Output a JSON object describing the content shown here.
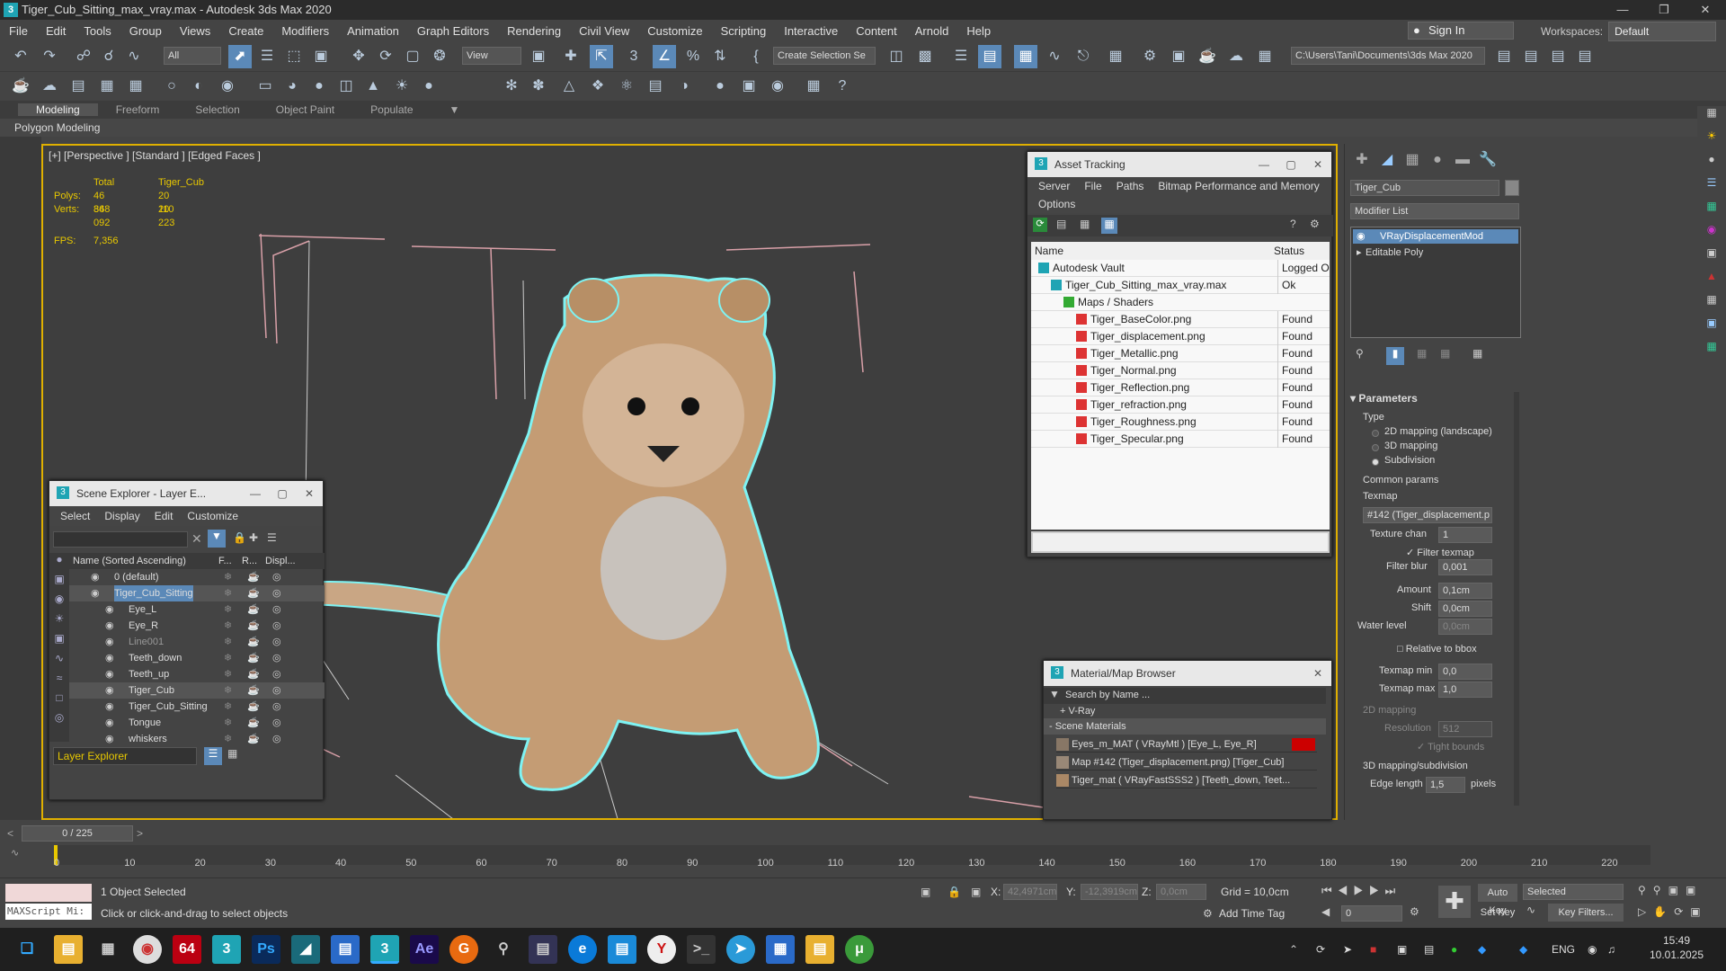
{
  "window": {
    "title": "Tiger_Cub_Sitting_max_vray.max - Autodesk 3ds Max 2020",
    "app_icon": "3"
  },
  "menu": [
    "File",
    "Edit",
    "Tools",
    "Group",
    "Views",
    "Create",
    "Modifiers",
    "Animation",
    "Graph Editors",
    "Rendering",
    "Civil View",
    "Customize",
    "Scripting",
    "Interactive",
    "Content",
    "Arnold",
    "Help"
  ],
  "signin": "Sign In",
  "workspaces": {
    "label": "Workspaces:",
    "value": "Default"
  },
  "toolbar": {
    "selection_filter": "All",
    "ref_coord": "View",
    "create_selection_set": "Create Selection Se",
    "project_path": "C:\\Users\\Tani\\Documents\\3ds Max 2020"
  },
  "ribbon": {
    "tabs": [
      "Modeling",
      "Freeform",
      "Selection",
      "Object Paint",
      "Populate"
    ],
    "active": "Modeling",
    "sub": "Polygon Modeling"
  },
  "viewport": {
    "label": "[+] [Perspective ] [Standard ] [Edged Faces ]",
    "stats": {
      "h_total": "Total",
      "h_obj": "Tiger_Cub",
      "polys_label": "Polys:",
      "polys_total": "46 868",
      "polys_obj": "20 110",
      "verts_label": "Verts:",
      "verts_total": "34 092",
      "verts_obj": "20 223",
      "fps_label": "FPS:",
      "fps": "7,356"
    }
  },
  "asset_tracking": {
    "title": "Asset Tracking",
    "menu": [
      "Server",
      "File",
      "Paths",
      "Bitmap Performance and Memory"
    ],
    "menu2": "Options",
    "col_name": "Name",
    "col_status": "Status",
    "rows": [
      {
        "name": "Autodesk Vault",
        "status": "Logged Ou",
        "indent": 0,
        "icon": "vault-icon"
      },
      {
        "name": "Tiger_Cub_Sitting_max_vray.max",
        "status": "Ok",
        "indent": 1,
        "icon": "max-file-icon"
      },
      {
        "name": "Maps / Shaders",
        "status": "",
        "indent": 2,
        "icon": "maps-icon"
      },
      {
        "name": "Tiger_BaseColor.png",
        "status": "Found",
        "indent": 3,
        "icon": "png-icon"
      },
      {
        "name": "Tiger_displacement.png",
        "status": "Found",
        "indent": 3,
        "icon": "png-icon"
      },
      {
        "name": "Tiger_Metallic.png",
        "status": "Found",
        "indent": 3,
        "icon": "png-icon"
      },
      {
        "name": "Tiger_Normal.png",
        "status": "Found",
        "indent": 3,
        "icon": "png-icon"
      },
      {
        "name": "Tiger_Reflection.png",
        "status": "Found",
        "indent": 3,
        "icon": "png-icon"
      },
      {
        "name": "Tiger_refraction.png",
        "status": "Found",
        "indent": 3,
        "icon": "png-icon"
      },
      {
        "name": "Tiger_Roughness.png",
        "status": "Found",
        "indent": 3,
        "icon": "png-icon"
      },
      {
        "name": "Tiger_Specular.png",
        "status": "Found",
        "indent": 3,
        "icon": "png-icon"
      }
    ]
  },
  "scene_explorer": {
    "title": "Scene Explorer - Layer E...",
    "menu": [
      "Select",
      "Display",
      "Edit",
      "Customize"
    ],
    "col_name": "Name (Sorted Ascending)",
    "col_f": "F...",
    "col_r": "R...",
    "col_d": "Displ...",
    "rows": [
      {
        "name": "0 (default)",
        "indent": 0,
        "sel": false
      },
      {
        "name": "Tiger_Cub_Sitting",
        "indent": 0,
        "sel": true
      },
      {
        "name": "Eye_L",
        "indent": 1,
        "sel": false
      },
      {
        "name": "Eye_R",
        "indent": 1,
        "sel": false
      },
      {
        "name": "Line001",
        "indent": 1,
        "sel": false,
        "dim": true
      },
      {
        "name": "Teeth_down",
        "indent": 1,
        "sel": false
      },
      {
        "name": "Teeth_up",
        "indent": 1,
        "sel": false
      },
      {
        "name": "Tiger_Cub",
        "indent": 1,
        "sel": true
      },
      {
        "name": "Tiger_Cub_Sitting",
        "indent": 1,
        "sel": false
      },
      {
        "name": "Tongue",
        "indent": 1,
        "sel": false
      },
      {
        "name": "whiskers",
        "indent": 1,
        "sel": false
      }
    ],
    "footer": "Layer Explorer"
  },
  "material_browser": {
    "title": "Material/Map Browser",
    "search_placeholder": "Search by Name ...",
    "vray": "+ V-Ray",
    "section": "- Scene Materials",
    "items": [
      "Eyes_m_MAT  ( VRayMtl ) [Eye_L, Eye_R]",
      "Map #142 (Tiger_displacement.png) [Tiger_Cub]",
      "Tiger_mat  ( VRayFastSSS2 ) [Teeth_down, Teet..."
    ]
  },
  "command_panel": {
    "object_name": "Tiger_Cub",
    "modifier_list": "Modifier List",
    "stack": [
      "VRayDisplacementMod",
      "Editable Poly"
    ],
    "rollout": "Parameters",
    "type_label": "Type",
    "types": [
      "2D mapping (landscape)",
      "3D mapping",
      "Subdivision"
    ],
    "type_selected": 2,
    "common_params": "Common params",
    "texmap_label": "Texmap",
    "texmap_value": "#142 (Tiger_displacement.p",
    "texture_chan_label": "Texture chan",
    "texture_chan": "1",
    "filter_texmap": "Filter texmap",
    "filter_blur_label": "Filter blur",
    "filter_blur": "0,001",
    "amount_label": "Amount",
    "amount": "0,1cm",
    "shift_label": "Shift",
    "shift": "0,0cm",
    "water_label": "Water level",
    "water": "0,0cm",
    "relative_bbox": "Relative to bbox",
    "texmap_min_label": "Texmap min",
    "texmap_min": "0,0",
    "texmap_max_label": "Texmap max",
    "texmap_max": "1,0",
    "mapping2d": "2D mapping",
    "resolution_label": "Resolution",
    "resolution": "512",
    "tight_bounds": "Tight bounds",
    "mapping3d": "3D mapping/subdivision",
    "edge_length_label": "Edge length",
    "edge_length": "1,5",
    "edge_unit": "pixels"
  },
  "timeline": {
    "frame": "0 / 225",
    "ticks": [
      "0",
      "10",
      "20",
      "30",
      "40",
      "50",
      "60",
      "70",
      "80",
      "90",
      "100",
      "110",
      "120",
      "130",
      "140",
      "150",
      "160",
      "170",
      "180",
      "190",
      "200",
      "210",
      "220"
    ]
  },
  "status": {
    "script": "MAXScript Mi:",
    "selected": "1 Object Selected",
    "hint": "Click or click-and-drag to select objects",
    "x_label": "X:",
    "x": "42,4971cm",
    "y_label": "Y:",
    "y": "-12,3919cm",
    "z_label": "Z:",
    "z": "0,0cm",
    "grid": "Grid = 10,0cm",
    "add_time_tag": "Add Time Tag",
    "auto_key": "Auto Key",
    "set_key": "Set Key",
    "selected_dd": "Selected",
    "key_filters": "Key Filters...",
    "frame_field": "0"
  },
  "taskbar": {
    "lang": "ENG",
    "time": "15:49",
    "date": "10.01.2025"
  }
}
